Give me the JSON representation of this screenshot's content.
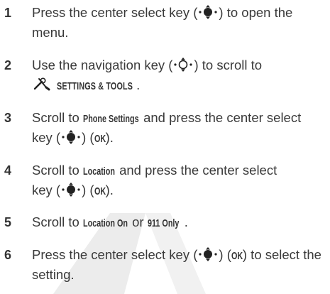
{
  "steps": [
    {
      "num": "1",
      "a": "Press the center select key (",
      "b": ") to open the",
      "c": "menu."
    },
    {
      "num": "2",
      "a": "Use the navigation key (",
      "b": ") to scroll to",
      "label": "SETTINGS & TOOLS",
      "c": "."
    },
    {
      "num": "3",
      "a": "Scroll to ",
      "label": "Phone Settings",
      "b": " and press the center select",
      "c": "key (",
      "d": ") (",
      "ok": "OK",
      "e": ")."
    },
    {
      "num": "4",
      "a": "Scroll to ",
      "label": "Location",
      "b": " and press the center select",
      "c": "key (",
      "d": ") (",
      "ok": "OK",
      "e": ")."
    },
    {
      "num": "5",
      "a": "Scroll to ",
      "label": "Location On",
      "b": " or ",
      "label2": "911 Only",
      "c": "."
    },
    {
      "num": "6",
      "a": "Press the center select key (",
      "b": ") (",
      "ok": "OK",
      "c": ") to select the",
      "d": "setting."
    }
  ],
  "icons": {
    "select_key": "center-select-key-icon",
    "nav_key": "navigation-key-icon",
    "tools": "settings-tools-icon"
  },
  "colors": {
    "text": "#3a3a3a",
    "watermark": "#ececec"
  }
}
